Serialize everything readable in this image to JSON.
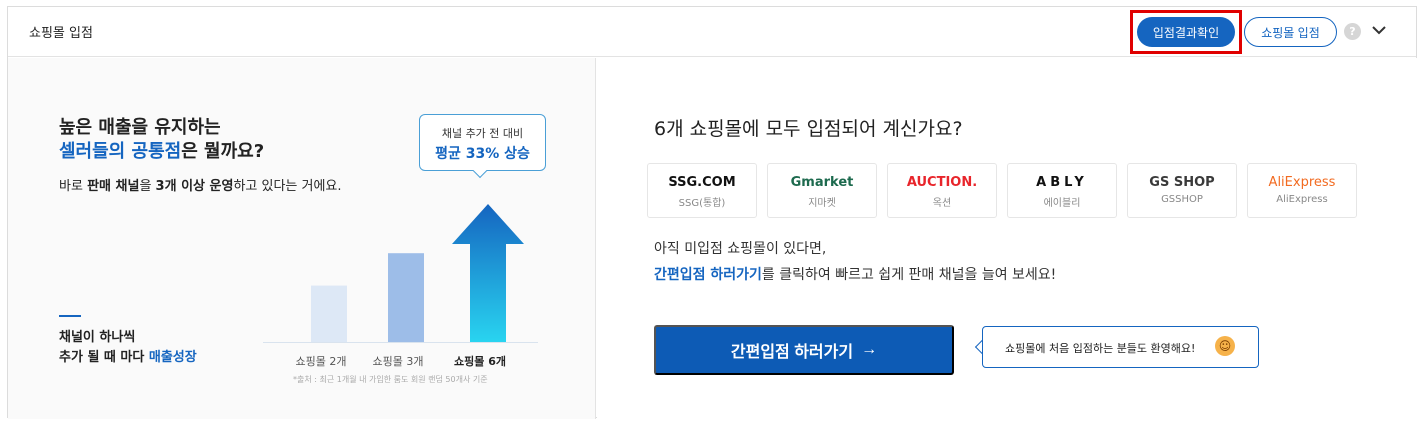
{
  "header": {
    "title": "쇼핑몰 입점",
    "result_button": "입점결과확인",
    "enter_button": "쇼핑몰 입점",
    "help_icon": "?",
    "colors": {
      "primary": "#1565c0",
      "highlight": "#e00000"
    }
  },
  "left": {
    "headline_line1": "높은 매출을 유지하는",
    "headline_line2_blue": "셀러들의 공통점",
    "headline_line2_rest": "은 뭘까요?",
    "sub_pre": "바로 ",
    "sub_bold1": "판매 채널",
    "sub_mid1": "을 ",
    "sub_bold2": "3개 이상 운영",
    "sub_post": "하고 있다는 거에요.",
    "growth_line1": "채널이 하나씩",
    "growth_line2_pre": "추가 될 때 마다 ",
    "growth_line2_blue": "매출성장",
    "bubble_line1": "채널 추가 전 대비",
    "bubble_line2": "평균 33% 상승",
    "footnote": "*출처 : 최근 1개월 내 가입한 룸도 회원 랜덤 50개사 기준"
  },
  "chart_data": {
    "type": "bar",
    "categories": [
      "쇼핑몰 2개",
      "쇼핑몰 3개",
      "쇼핑몰 6개"
    ],
    "values": [
      47,
      74,
      100
    ],
    "title": "",
    "xlabel": "",
    "ylabel": "",
    "colors": [
      "#dde8f6",
      "#9dbde8",
      "#1e88e5"
    ],
    "annotation": "평균 33% 상승"
  },
  "right": {
    "question": "6개 쇼핑몰에 모두 입점되어 계신가요?",
    "malls": [
      {
        "logo": "SSG.COM",
        "name": "SSG(통합)",
        "color": "#111111"
      },
      {
        "logo": "Gmarket",
        "name": "지마켓",
        "color": "#1d6a4e"
      },
      {
        "logo": "AUCTION.",
        "name": "옥션",
        "color": "#e8252b"
      },
      {
        "logo": "ABLY",
        "name": "에이블리",
        "color": "#111111"
      },
      {
        "logo": "GS SHOP",
        "name": "GSSHOP",
        "color": "#3a3a3a"
      },
      {
        "logo": "AliExpress",
        "name": "AliExpress",
        "color": "#f26b21"
      }
    ],
    "info_line1": "아직 미입점 쇼핑몰이 있다면,",
    "info_link": "간편입점 하러가기",
    "info_rest": "를 클릭하여 빠르고 쉽게 판매 채널을 늘여 보세요!",
    "cta_label": "간편입점 하러가기",
    "cta_arrow": "→",
    "welcome": "쇼핑몰에 처음 입점하는 분들도 환영해요!",
    "welcome_icon": "smile-emoji"
  }
}
